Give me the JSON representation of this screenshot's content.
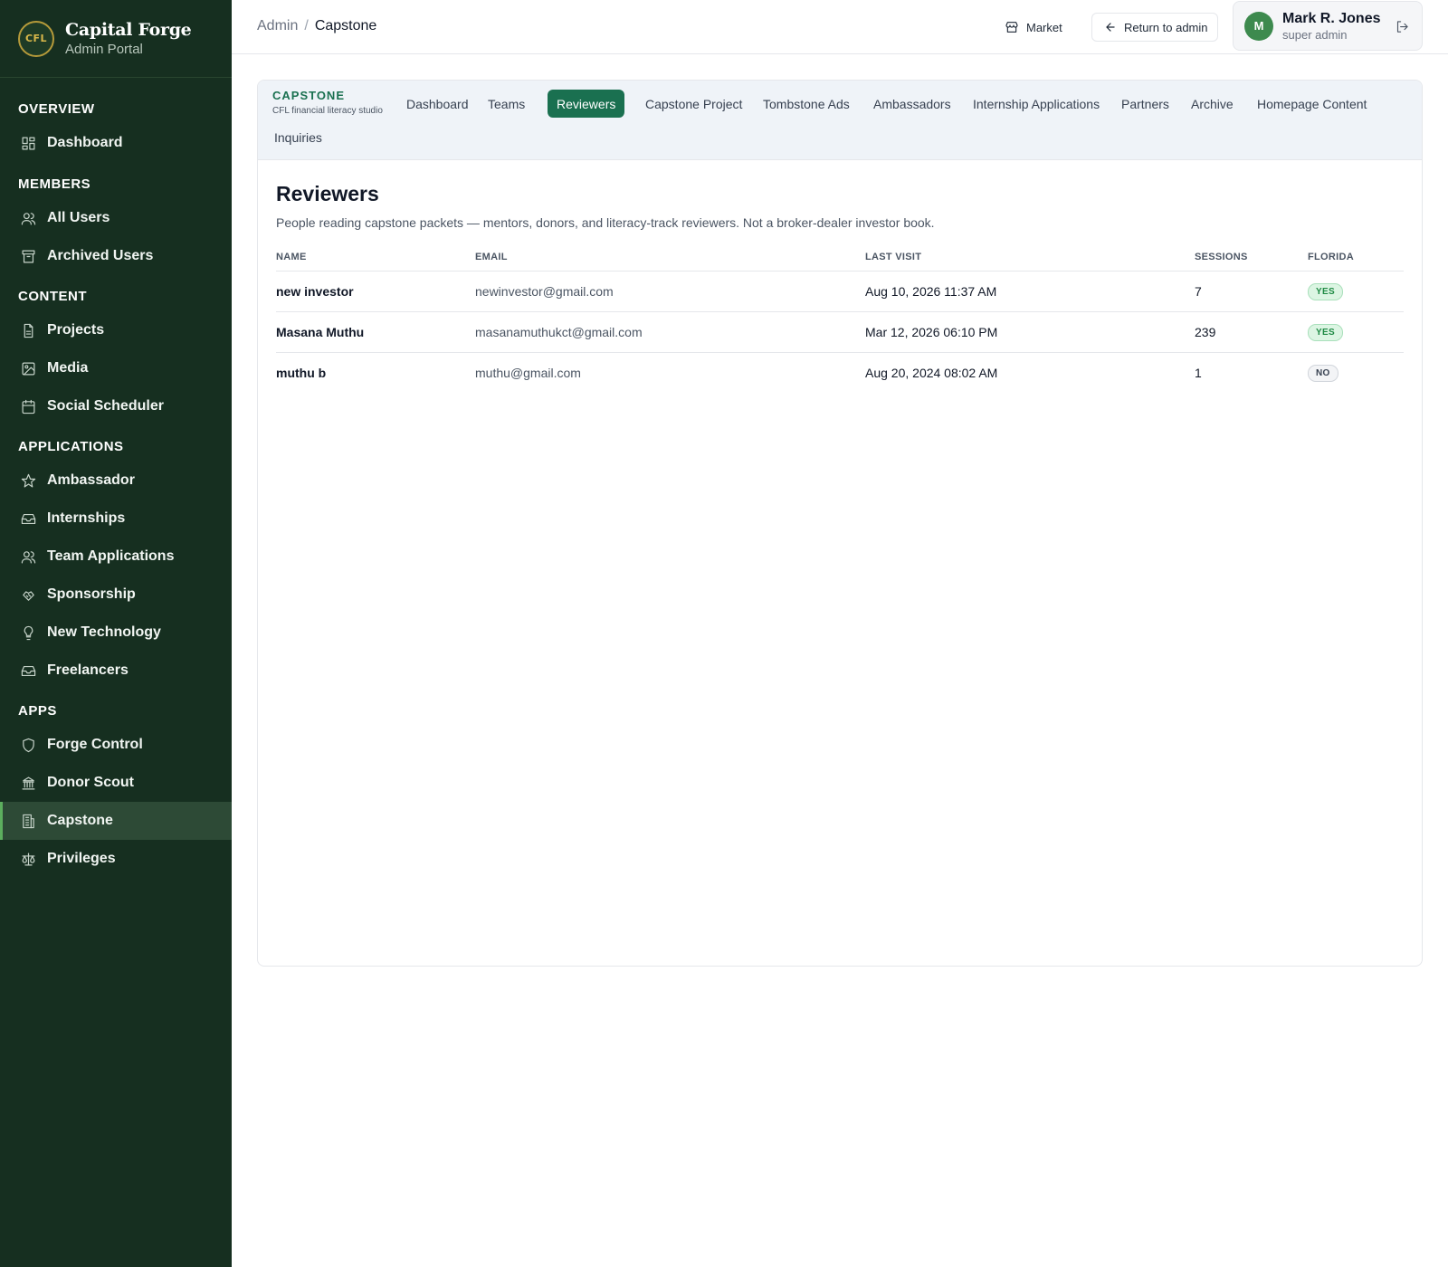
{
  "brand": {
    "logo_text": "CFL",
    "title": "Capital Forge",
    "subtitle": "Admin Portal"
  },
  "sidebar": {
    "sections": [
      {
        "label": "OVERVIEW",
        "items": [
          {
            "label": "Dashboard",
            "icon": "dashboard-icon"
          }
        ]
      },
      {
        "label": "MEMBERS",
        "items": [
          {
            "label": "All Users",
            "icon": "users-icon"
          },
          {
            "label": "Archived Users",
            "icon": "archive-icon"
          }
        ]
      },
      {
        "label": "CONTENT",
        "items": [
          {
            "label": "Projects",
            "icon": "file-icon"
          },
          {
            "label": "Media",
            "icon": "image-icon"
          },
          {
            "label": "Social Scheduler",
            "icon": "calendar-icon"
          }
        ]
      },
      {
        "label": "APPLICATIONS",
        "items": [
          {
            "label": "Ambassador",
            "icon": "star-icon"
          },
          {
            "label": "Internships",
            "icon": "inbox-icon"
          },
          {
            "label": "Team Applications",
            "icon": "users-icon"
          },
          {
            "label": "Sponsorship",
            "icon": "handshake-icon"
          },
          {
            "label": "New Technology",
            "icon": "lightbulb-icon"
          },
          {
            "label": "Freelancers",
            "icon": "inbox-icon"
          }
        ]
      },
      {
        "label": "APPS",
        "items": [
          {
            "label": "Forge Control",
            "icon": "shield-icon"
          },
          {
            "label": "Donor Scout",
            "icon": "bank-icon"
          },
          {
            "label": "Capstone",
            "icon": "building-icon",
            "active": true
          },
          {
            "label": "Privileges",
            "icon": "scale-icon"
          }
        ]
      }
    ]
  },
  "breadcrumb": {
    "root": "Admin",
    "separator": "/",
    "current": "Capstone"
  },
  "header": {
    "market_label": "Market",
    "return_label": "Return to admin"
  },
  "user": {
    "initial": "M",
    "name": "Mark R. Jones",
    "role": "super admin"
  },
  "module": {
    "title": "CAPSTONE",
    "subtitle": "CFL financial literacy studio",
    "tabs": [
      "Dashboard",
      "Teams",
      "Reviewers",
      "Capstone Project",
      "Tombstone Ads",
      "Ambassadors",
      "Internship Applications",
      "Partners",
      "Archive",
      "Homepage Content",
      "Inquiries"
    ],
    "active_tab": "Reviewers"
  },
  "page": {
    "title": "Reviewers",
    "description": "People reading capstone packets — mentors, donors, and literacy-track reviewers. Not a broker-dealer investor book."
  },
  "table": {
    "columns": [
      "NAME",
      "EMAIL",
      "LAST VISIT",
      "SESSIONS",
      "FLORIDA"
    ],
    "rows": [
      {
        "name": "new investor",
        "email": "newinvestor@gmail.com",
        "last_visit": "Aug 10, 2026 11:37 AM",
        "sessions": "7",
        "florida": "YES"
      },
      {
        "name": "Masana Muthu",
        "email": "masanamuthukct@gmail.com",
        "last_visit": "Mar 12, 2026 06:10 PM",
        "sessions": "239",
        "florida": "YES"
      },
      {
        "name": "muthu b",
        "email": "muthu@gmail.com",
        "last_visit": "Aug 20, 2024 08:02 AM",
        "sessions": "1",
        "florida": "NO"
      }
    ]
  },
  "colors": {
    "sidebar_bg": "#162f20",
    "accent": "#1a7050",
    "active_indicator": "#5cae5e"
  }
}
